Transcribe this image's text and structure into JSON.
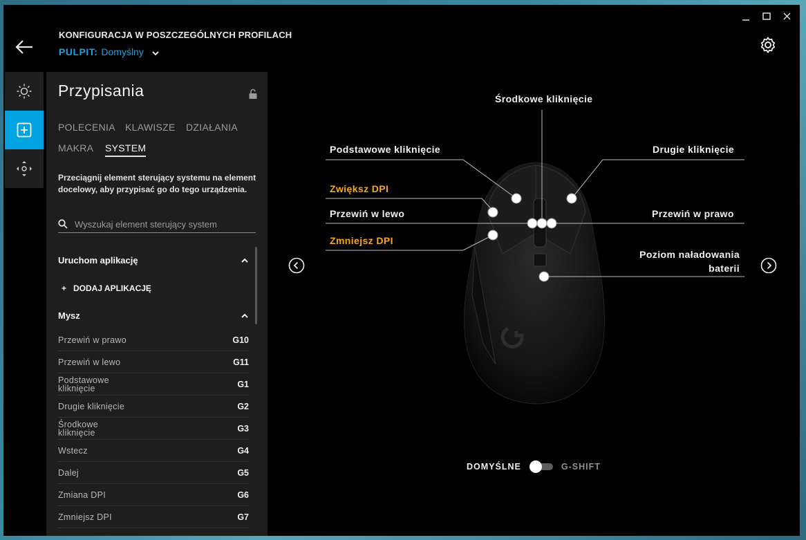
{
  "header": {
    "title": "KONFIGURACJA W POSZCZEGÓLNYCH PROFILACH",
    "profile_label": "PULPIT:",
    "profile_value": "Domyślny"
  },
  "colors": {
    "accent": "#00a3e0",
    "profile_blue": "#19a3e0",
    "highlight_orange": "#f7a81b"
  },
  "rail": {
    "items": [
      {
        "icon": "brightness-icon",
        "active": false
      },
      {
        "icon": "assignments-plus-icon",
        "active": true
      },
      {
        "icon": "move-dpad-icon",
        "active": false
      }
    ]
  },
  "panel": {
    "title": "Przypisania",
    "tabs": [
      {
        "label": "POLECENIA",
        "active": false
      },
      {
        "label": "KLAWISZE",
        "active": false
      },
      {
        "label": "DZIAŁANIA",
        "active": false
      },
      {
        "label": "MAKRA",
        "active": false
      },
      {
        "label": "SYSTEM",
        "active": true
      }
    ],
    "description": "Przeciągnij element sterujący systemu na element docelowy, aby przypisać go do tego urządzenia.",
    "search_placeholder": "Wyszukaj element sterujący system",
    "section_apps": "Uruchom aplikację",
    "add_app": "DODAJ APLIKACJĘ",
    "section_mouse": "Mysz",
    "mouse_items": [
      {
        "name": "Przewiń w prawo",
        "key": "G10"
      },
      {
        "name": "Przewiń w lewo",
        "key": "G11"
      },
      {
        "name": "Podstawowe kliknięcie",
        "key": "G1"
      },
      {
        "name": "Drugie kliknięcie",
        "key": "G2"
      },
      {
        "name": "Środkowe kliknięcie",
        "key": "G3"
      },
      {
        "name": "Wstecz",
        "key": "G4"
      },
      {
        "name": "Dalej",
        "key": "G5"
      },
      {
        "name": "Zmiana DPI",
        "key": "G6"
      },
      {
        "name": "Zmniejsz DPI",
        "key": "G7"
      }
    ]
  },
  "mouse_labels": {
    "middle": "Środkowe kliknięcie",
    "primary": "Podstawowe kliknięcie",
    "secondary": "Drugie kliknięcie",
    "dpi_up": "Zwiększ DPI",
    "scroll_left": "Przewiń w lewo",
    "scroll_right": "Przewiń w prawo",
    "dpi_down": "Zmniejsz DPI",
    "battery_line1": "Poziom naładowania",
    "battery_line2": "baterii"
  },
  "mode_toggle": {
    "left": "DOMYŚLNE",
    "right": "G-SHIFT",
    "state": "default"
  }
}
